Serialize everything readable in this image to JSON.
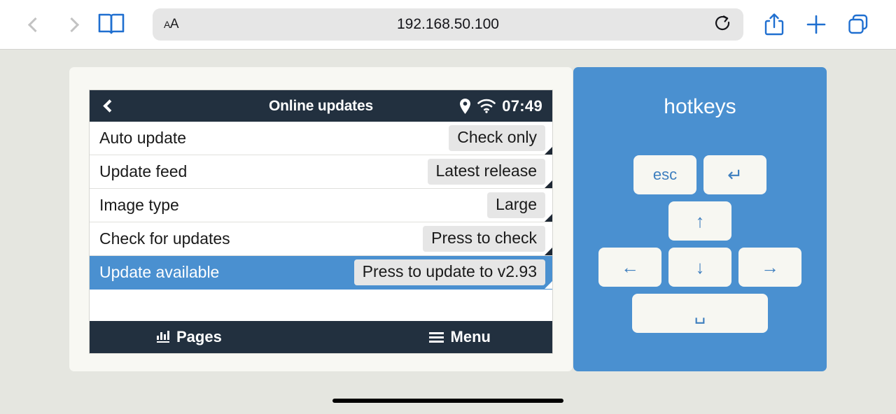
{
  "browser": {
    "back_icon": "chevron-left-icon",
    "forward_icon": "chevron-right-icon",
    "bookmarks_icon": "book-icon",
    "text_size_label_small": "A",
    "text_size_label_large": "A",
    "url": "192.168.50.100",
    "reload_icon": "reload-icon",
    "share_icon": "share-icon",
    "new_tab_icon": "plus-icon",
    "tabs_icon": "tabs-icon",
    "accent_color": "#1f6fd0"
  },
  "device": {
    "header": {
      "back_icon": "chevron-left-icon",
      "title": "Online updates",
      "location_icon": "location-pin-icon",
      "wifi_icon": "wifi-icon",
      "time": "07:49",
      "bg_color": "#22303f"
    },
    "rows": [
      {
        "label": "Auto update",
        "value": "Check only",
        "selected": false
      },
      {
        "label": "Update feed",
        "value": "Latest release",
        "selected": false
      },
      {
        "label": "Image type",
        "value": "Large",
        "selected": false
      },
      {
        "label": "Check for updates",
        "value": "Press to check",
        "selected": false
      },
      {
        "label": "Update available",
        "value": "Press to update to v2.93",
        "selected": true
      }
    ],
    "footer": {
      "pages_label": "Pages",
      "pages_icon": "bar-chart-icon",
      "menu_label": "Menu",
      "menu_icon": "hamburger-icon"
    },
    "selected_color": "#4a90d0"
  },
  "hotkeys": {
    "title": "hotkeys",
    "keys": [
      {
        "name": "esc-key",
        "label": "esc",
        "type": "text"
      },
      {
        "name": "enter-key",
        "label": "↵",
        "type": "glyph"
      },
      {
        "name": "arrow-up-key",
        "label": "↑",
        "type": "glyph"
      },
      {
        "name": "arrow-left-key",
        "label": "←",
        "type": "glyph"
      },
      {
        "name": "arrow-down-key",
        "label": "↓",
        "type": "glyph"
      },
      {
        "name": "arrow-right-key",
        "label": "→",
        "type": "glyph"
      },
      {
        "name": "space-key",
        "label": "␣",
        "type": "glyph"
      }
    ],
    "bg_color": "#4a90d0"
  },
  "page": {
    "background_color": "#e5e6e0",
    "card_color": "#f8f8f3"
  }
}
